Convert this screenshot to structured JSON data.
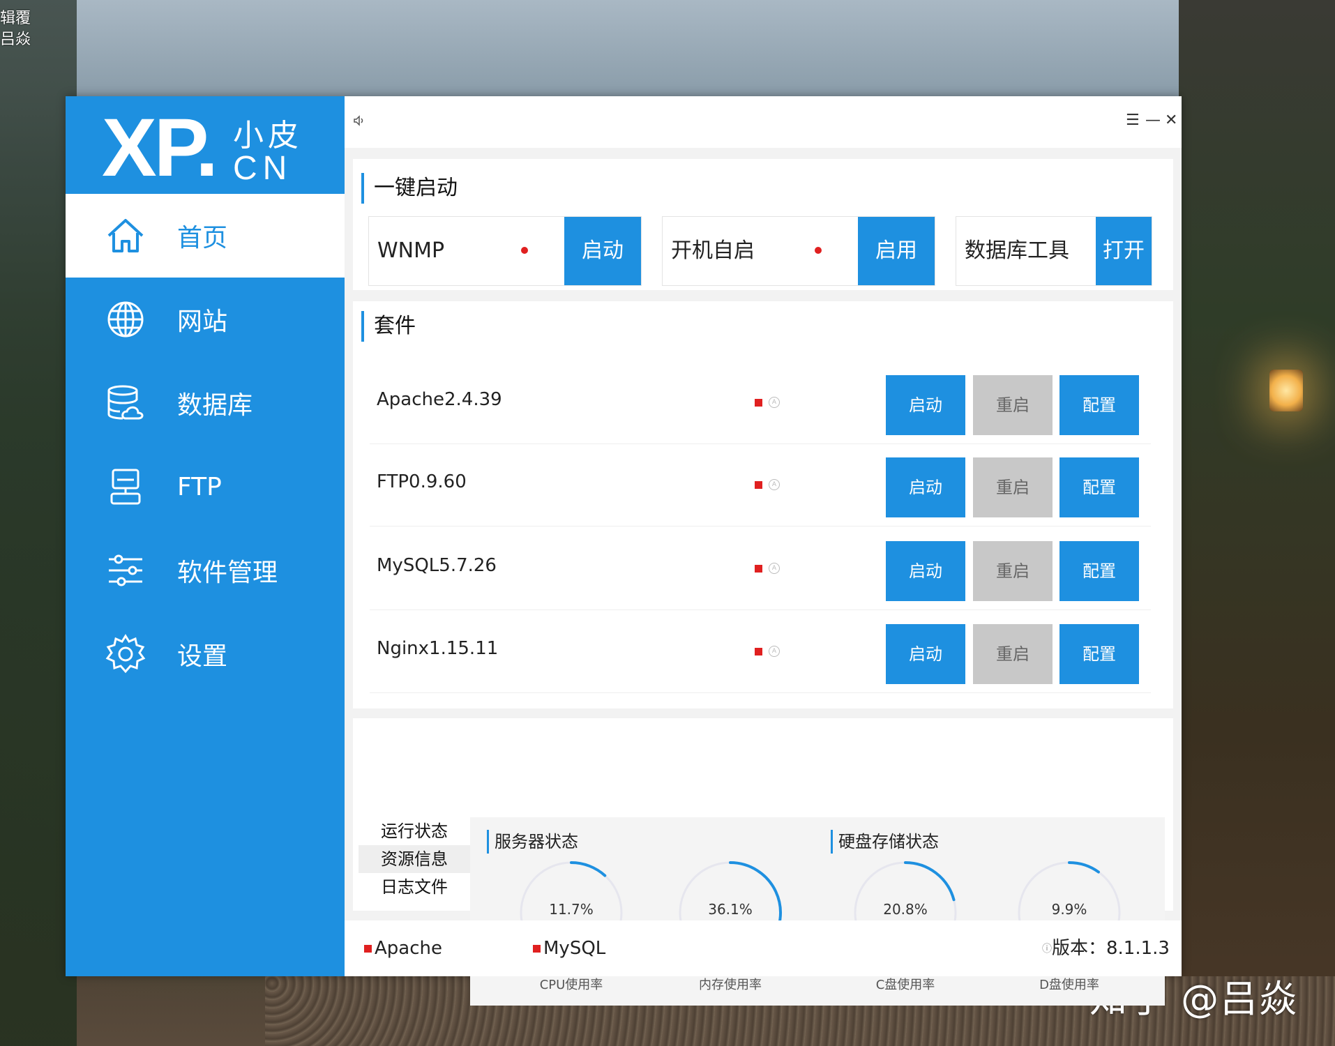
{
  "desktop": {
    "corner_text": [
      "辑覆",
      "吕焱"
    ],
    "watermark": "知乎 @吕焱"
  },
  "logo": {
    "xp": "XP.",
    "small": "小皮",
    "cn": "CN"
  },
  "sidebar": {
    "items": [
      {
        "label": "首页",
        "icon": "home-icon",
        "active": true
      },
      {
        "label": "网站",
        "icon": "globe-icon"
      },
      {
        "label": "数据库",
        "icon": "database-icon"
      },
      {
        "label": "FTP",
        "icon": "ftp-icon"
      },
      {
        "label": "软件管理",
        "icon": "sliders-icon"
      },
      {
        "label": "设置",
        "icon": "gear-icon"
      }
    ]
  },
  "titlebar": {
    "speaker_icon": "speaker-icon",
    "menu": "☰",
    "minimize": "—",
    "close": "✕"
  },
  "quick_start": {
    "title": "一键启动",
    "items": [
      {
        "label": "WNMP",
        "button": "启动",
        "status_color": "#e02020"
      },
      {
        "label": "开机自启",
        "button": "启用",
        "status_color": "#e02020"
      },
      {
        "label": "数据库工具",
        "button": "打开"
      }
    ]
  },
  "suite": {
    "title": "套件",
    "rows": [
      {
        "name": "Apache2.4.39",
        "start": "启动",
        "restart": "重启",
        "config": "配置"
      },
      {
        "name": "FTP0.9.60",
        "start": "启动",
        "restart": "重启",
        "config": "配置"
      },
      {
        "name": "MySQL5.7.26",
        "start": "启动",
        "restart": "重启",
        "config": "配置"
      },
      {
        "name": "Nginx1.15.11",
        "start": "启动",
        "restart": "重启",
        "config": "配置"
      }
    ],
    "status_color": "#e02020"
  },
  "info": {
    "tabs": [
      "运行状态",
      "资源信息",
      "日志文件"
    ],
    "active_tab": 1,
    "server_title": "服务器状态",
    "disk_title": "硬盘存储状态",
    "gauges": [
      {
        "value": "11.7%",
        "percent": 11.7,
        "caption": "CPU使用率"
      },
      {
        "value": "36.1%",
        "percent": 36.1,
        "caption": "内存使用率"
      },
      {
        "value": "20.8%",
        "percent": 20.8,
        "caption": "C盘使用率"
      },
      {
        "value": "9.9%",
        "percent": 9.9,
        "caption": "D盘使用率"
      }
    ]
  },
  "statusbar": {
    "items": [
      "Apache",
      "MySQL"
    ],
    "version_label": "版本：8.1.1.3"
  },
  "colors": {
    "accent": "#1e90e0",
    "stopped": "#e02020",
    "gray_button": "#c8c8c8"
  }
}
